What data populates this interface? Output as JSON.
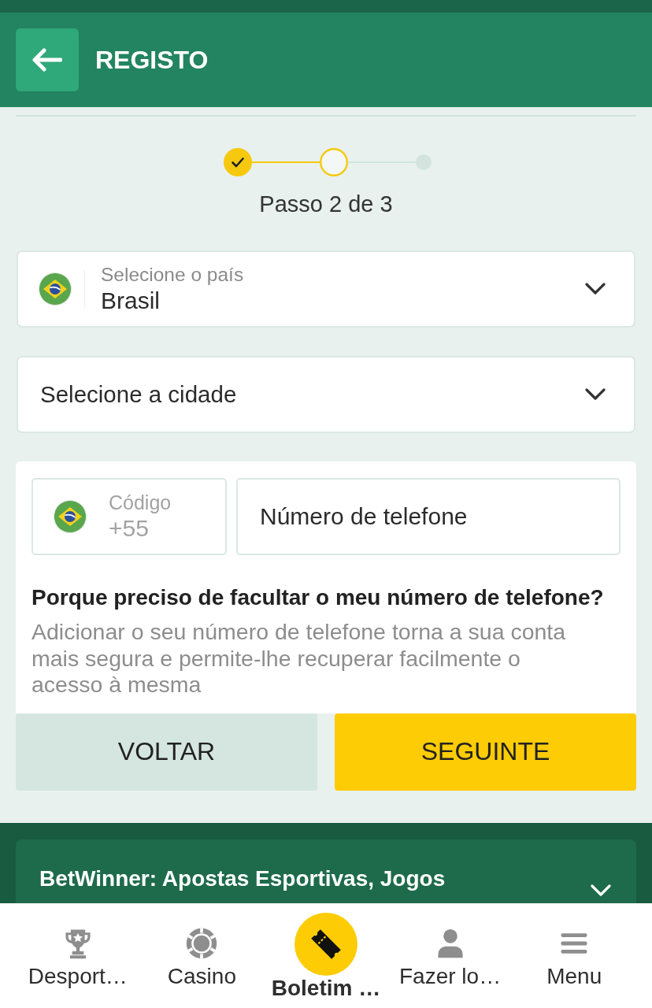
{
  "header": {
    "title": "REGISTO"
  },
  "stepper": {
    "steps": [
      {
        "done": true,
        "current": false
      },
      {
        "done": false,
        "current": true
      },
      {
        "done": false,
        "current": false
      }
    ],
    "caption": "Passo 2 de 3"
  },
  "country_select": {
    "label": "Selecione o país",
    "value": "Brasil"
  },
  "city_select": {
    "placeholder": "Selecione a cidade"
  },
  "phone": {
    "code_label": "Código",
    "code_value": "+55",
    "number_placeholder": "Número de telefone",
    "question": "Porque preciso de facultar o meu número de telefone?",
    "explanation": "Adicionar o seu número de telefone torna a sua conta mais segura e permite-lhe recuperar facilmente o acesso à mesma"
  },
  "buttons": [
    {
      "label": "VOLTAR",
      "kind": "secondary"
    },
    {
      "label": "SEGUINTE",
      "kind": "primary"
    }
  ],
  "footer": {
    "title": "BetWinner: Apostas Esportivas, Jogos",
    "expanded": false
  },
  "bottom_nav": {
    "items": [
      {
        "label": "Desport…",
        "selected": false
      },
      {
        "label": "Casino",
        "selected": false
      },
      {
        "label": "Boletim …",
        "selected": true
      },
      {
        "label": "Fazer lo…",
        "selected": false
      },
      {
        "label": "Menu",
        "selected": false
      }
    ]
  }
}
